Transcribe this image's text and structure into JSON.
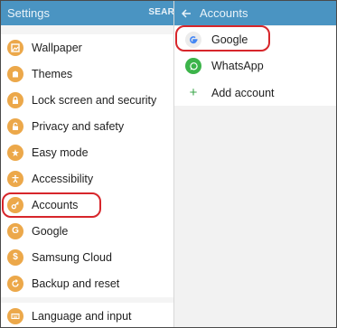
{
  "left": {
    "title": "Settings",
    "search_label": "SEAR",
    "items": [
      {
        "label": "Wallpaper",
        "icon": "wallpaper-icon"
      },
      {
        "label": "Themes",
        "icon": "themes-icon"
      },
      {
        "label": "Lock screen and security",
        "icon": "lock-icon"
      },
      {
        "label": "Privacy and safety",
        "icon": "privacy-icon"
      },
      {
        "label": "Easy mode",
        "icon": "easy-mode-icon"
      },
      {
        "label": "Accessibility",
        "icon": "accessibility-icon"
      },
      {
        "label": "Accounts",
        "icon": "key-icon"
      },
      {
        "label": "Google",
        "icon": "google-icon"
      },
      {
        "label": "Samsung Cloud",
        "icon": "samsung-cloud-icon"
      },
      {
        "label": "Backup and reset",
        "icon": "backup-icon"
      }
    ],
    "items2": [
      {
        "label": "Language and input",
        "icon": "language-icon"
      }
    ]
  },
  "right": {
    "title": "Accounts",
    "items": [
      {
        "label": "Google",
        "icon": "google-icon"
      },
      {
        "label": "WhatsApp",
        "icon": "whatsapp-icon"
      },
      {
        "label": "Add account",
        "icon": "plus-icon"
      }
    ]
  },
  "colors": {
    "appbar": "#4a94c2",
    "icon_orange": "#eca84a",
    "highlight_red": "#d7262b",
    "whatsapp_green": "#3cb44a"
  }
}
